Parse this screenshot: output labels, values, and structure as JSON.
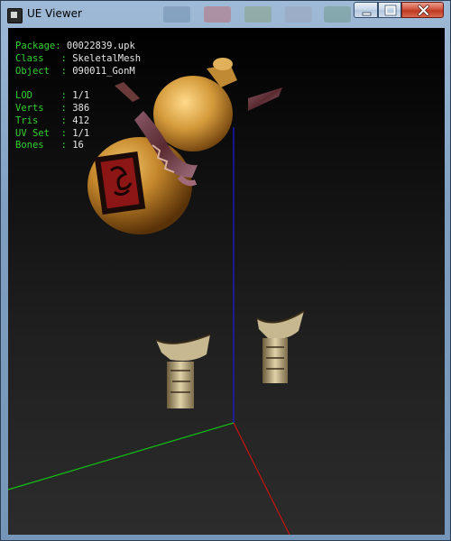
{
  "window": {
    "title": "UE Viewer"
  },
  "stats": {
    "package_label": "Package: ",
    "package": "00022839.upk",
    "class_label": "Class   : ",
    "class": "SkeletalMesh",
    "object_label": "Object  : ",
    "object": "090011_GonM",
    "lod_label": "LOD     : ",
    "lod": "1/1",
    "verts_label": "Verts   : ",
    "verts": "386",
    "tris_label": "Tris    : ",
    "tris": "412",
    "uvset_label": "UV Set  : ",
    "uvset": "1/1",
    "bones_label": "Bones   : ",
    "bones": "16"
  },
  "colors": {
    "stats_key": "#34d134",
    "stats_value": "#e6e6e6",
    "axis_x": "#cc1111",
    "axis_y": "#11c411",
    "axis_z": "#1a1ae0"
  },
  "icons": [
    "app-icon",
    "minimize-icon",
    "maximize-icon",
    "close-icon"
  ]
}
